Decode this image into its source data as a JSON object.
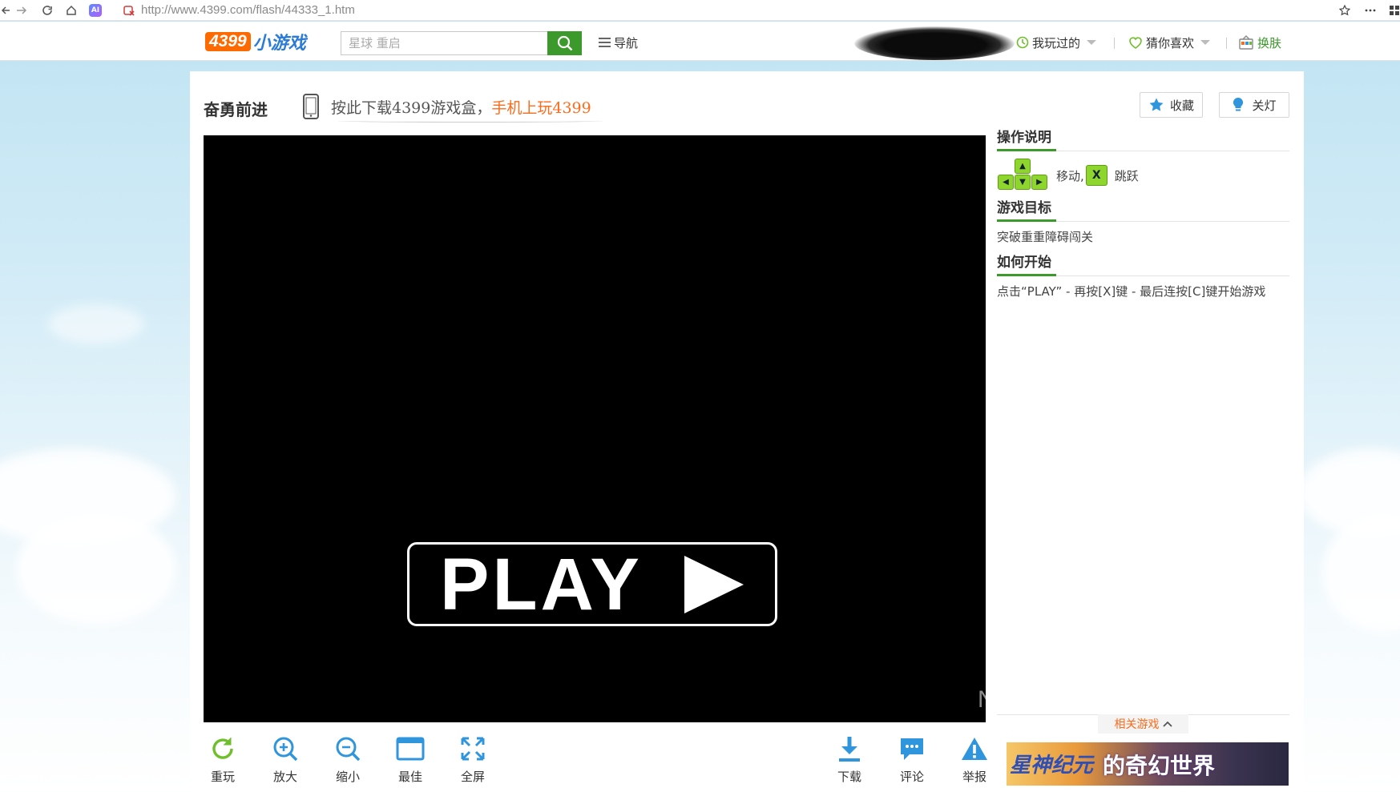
{
  "browser": {
    "url": "http://www.4399.com/flash/44333_1.htm",
    "ai_badge": "AI"
  },
  "header": {
    "logo_number": "4399",
    "logo_text": "小游戏",
    "search_placeholder": "星球 重启",
    "nav_label": "导航",
    "played_label": "我玩过的",
    "guess_label": "猜你喜欢",
    "skin_label": "换肤",
    "accent": "#3c9a2c",
    "logo_orange": "#ff6a00",
    "logo_blue": "#2b7bd7"
  },
  "game": {
    "title": "奋勇前进",
    "promo_text": "按此下载4399游戏盒，",
    "promo_highlight": "手机上玩4399",
    "favorite_label": "收藏",
    "lights_label": "关灯",
    "play_label": "PLAY"
  },
  "sidebar": {
    "controls_heading": "操作说明",
    "controls_move": "移动,",
    "controls_key": "X",
    "controls_jump": "跳跃",
    "goal_heading": "游戏目标",
    "goal_text": "突破重重障碍闯关",
    "start_heading": "如何开始",
    "start_text": "点击“PLAY” - 再按[X]键 - 最后连按[C]键开始游戏",
    "related_label": "相关游戏",
    "banner_text_1": "星神纪元",
    "banner_text_2": "的奇幻世界",
    "watermark": "N @hhcgchpspk"
  },
  "toolbar": {
    "replay": "重玩",
    "zoom_in": "放大",
    "zoom_out": "缩小",
    "best": "最佳",
    "fullscreen": "全屏",
    "download": "下载",
    "comment": "评论",
    "report": "举报",
    "green": "#6fbf2a",
    "blue": "#2f95dc"
  }
}
